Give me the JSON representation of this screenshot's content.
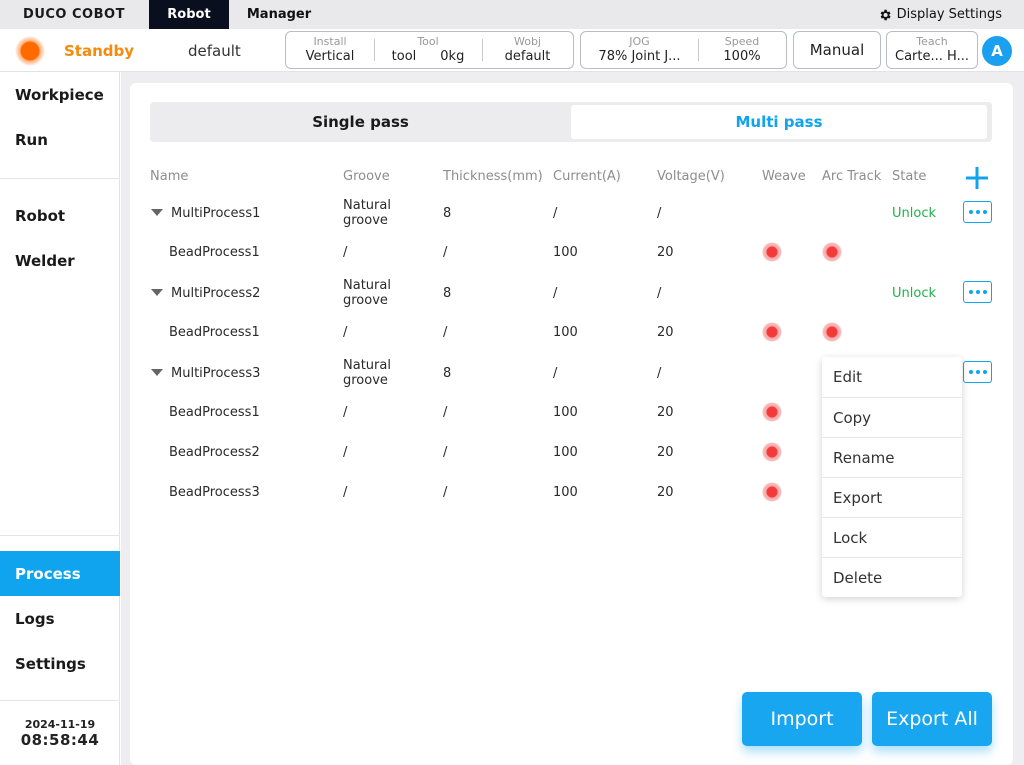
{
  "topbar": {
    "brand": "DUCO COBOT",
    "tabs": [
      {
        "label": "Robot"
      },
      {
        "label": "Manager"
      }
    ],
    "display_settings": "Display Settings"
  },
  "status": {
    "state": "Standby",
    "state_color": "#f58a0b",
    "program": "default",
    "install": {
      "label": "Install",
      "value": "Vertical"
    },
    "tool": {
      "label": "Tool",
      "value": "tool",
      "weight": "0kg"
    },
    "wobj": {
      "label": "Wobj",
      "value": "default"
    },
    "jog": {
      "label": "JOG",
      "value": "78%  Joint J..."
    },
    "speed": {
      "label": "Speed",
      "value": "100%"
    },
    "mode": "Manual",
    "teach": {
      "label": "Teach",
      "value": "Carte... H..."
    },
    "avatar": "A"
  },
  "sidebar": {
    "items": [
      {
        "label": "Workpiece"
      },
      {
        "label": "Run"
      },
      {
        "label": "Robot"
      },
      {
        "label": "Welder"
      },
      {
        "label": "Process",
        "active": true
      },
      {
        "label": "Logs"
      },
      {
        "label": "Settings"
      }
    ],
    "date": "2024-11-19",
    "time": "08:58:44"
  },
  "segment": {
    "single": "Single pass",
    "multi": "Multi pass",
    "selected": "Multi pass"
  },
  "table": {
    "headers": [
      "Name",
      "Groove",
      "Thickness(mm)",
      "Current(A)",
      "Voltage(V)",
      "Weave",
      "Arc Track",
      "State"
    ],
    "rows": [
      {
        "type": "group",
        "name": "MultiProcess1",
        "groove": [
          "Natural",
          "groove"
        ],
        "thickness": "8",
        "current": "/",
        "voltage": "/",
        "weave": false,
        "arc": false,
        "state": "Unlock",
        "menu": true
      },
      {
        "type": "bead",
        "name": "BeadProcess1",
        "groove": "/",
        "thickness": "/",
        "current": "100",
        "voltage": "20",
        "weave": true,
        "arc": true
      },
      {
        "type": "group",
        "name": "MultiProcess2",
        "groove": [
          "Natural",
          "groove"
        ],
        "thickness": "8",
        "current": "/",
        "voltage": "/",
        "weave": false,
        "arc": false,
        "state": "Unlock",
        "menu": true
      },
      {
        "type": "bead",
        "name": "BeadProcess1",
        "groove": "/",
        "thickness": "/",
        "current": "100",
        "voltage": "20",
        "weave": true,
        "arc": true
      },
      {
        "type": "group",
        "name": "MultiProcess3",
        "groove": [
          "Natural",
          "groove"
        ],
        "thickness": "8",
        "current": "/",
        "voltage": "/",
        "weave": false,
        "arc": false,
        "state": "",
        "menu": true
      },
      {
        "type": "bead",
        "name": "BeadProcess1",
        "groove": "/",
        "thickness": "/",
        "current": "100",
        "voltage": "20",
        "weave": true,
        "arc": false
      },
      {
        "type": "bead",
        "name": "BeadProcess2",
        "groove": "/",
        "thickness": "/",
        "current": "100",
        "voltage": "20",
        "weave": true,
        "arc": false
      },
      {
        "type": "bead",
        "name": "BeadProcess3",
        "groove": "/",
        "thickness": "/",
        "current": "100",
        "voltage": "20",
        "weave": true,
        "arc": false
      }
    ]
  },
  "context_menu": {
    "items": [
      "Edit",
      "Copy",
      "Rename",
      "Export",
      "Lock",
      "Delete"
    ]
  },
  "buttons": {
    "import": "Import",
    "export_all": "Export All"
  },
  "colors": {
    "accent": "#10a4ee",
    "unlock": "#21b14a",
    "indicator_red": "#f23a3a"
  }
}
